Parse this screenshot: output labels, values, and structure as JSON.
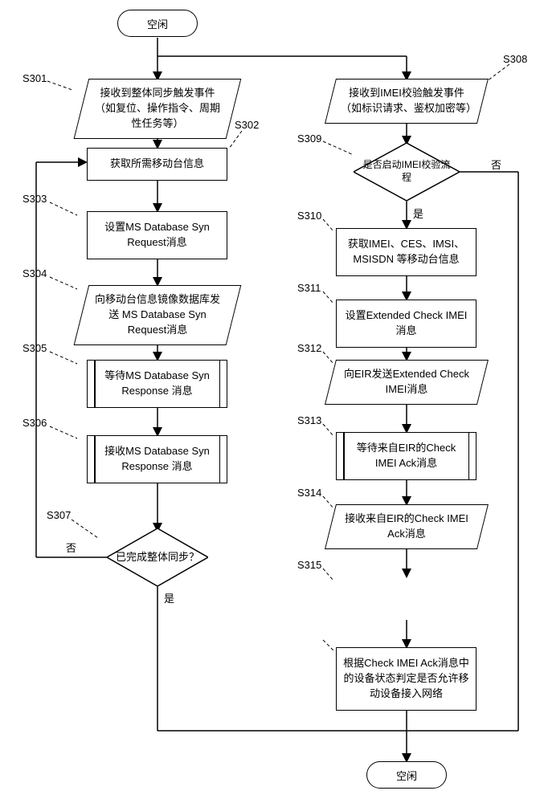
{
  "terminators": {
    "idle": "空闲"
  },
  "left": {
    "s301_label": "S301",
    "s301_text": "接收到整体同步触发事件（如复位、操作指令、周期性任务等）",
    "s302_label": "S302",
    "s302_text": "获取所需移动台信息",
    "s303_label": "S303",
    "s303_text": "设置MS Database Syn Request消息",
    "s304_label": "S304",
    "s304_text": "向移动台信息镜像数据库发送 MS Database Syn Request消息",
    "s305_label": "S305",
    "s305_text": "等待MS Database Syn Response 消息",
    "s306_label": "S306",
    "s306_text": "接收MS Database Syn Response 消息",
    "s307_label": "S307",
    "s307_text": "已完成整体同步？",
    "s307_no": "否",
    "s307_yes": "是"
  },
  "right": {
    "s308_label": "S308",
    "s308_text": "接收到IMEI校验触发事件（如标识请求、鉴权加密等）",
    "s309_label": "S309",
    "s309_text": "是否启动IMEI校验流程",
    "s309_no": "否",
    "s309_yes": "是",
    "s310_label": "S310",
    "s310_text": "获取IMEI、CES、IMSI、MSISDN 等移动台信息",
    "s311_label": "S311",
    "s311_text": "设置Extended Check IMEI消息",
    "s312_label": "S312",
    "s312_text": "向EIR发送Extended Check IMEI消息",
    "s313_label": "S313",
    "s313_text": "等待来自EIR的Check IMEI Ack消息",
    "s314_label": "S314",
    "s314_text": "接收来自EIR的Check IMEI Ack消息",
    "s315_label": "S315",
    "s315_text": "根据Check IMEI Ack消息中的设备状态判定是否允许移动设备接入网络"
  }
}
